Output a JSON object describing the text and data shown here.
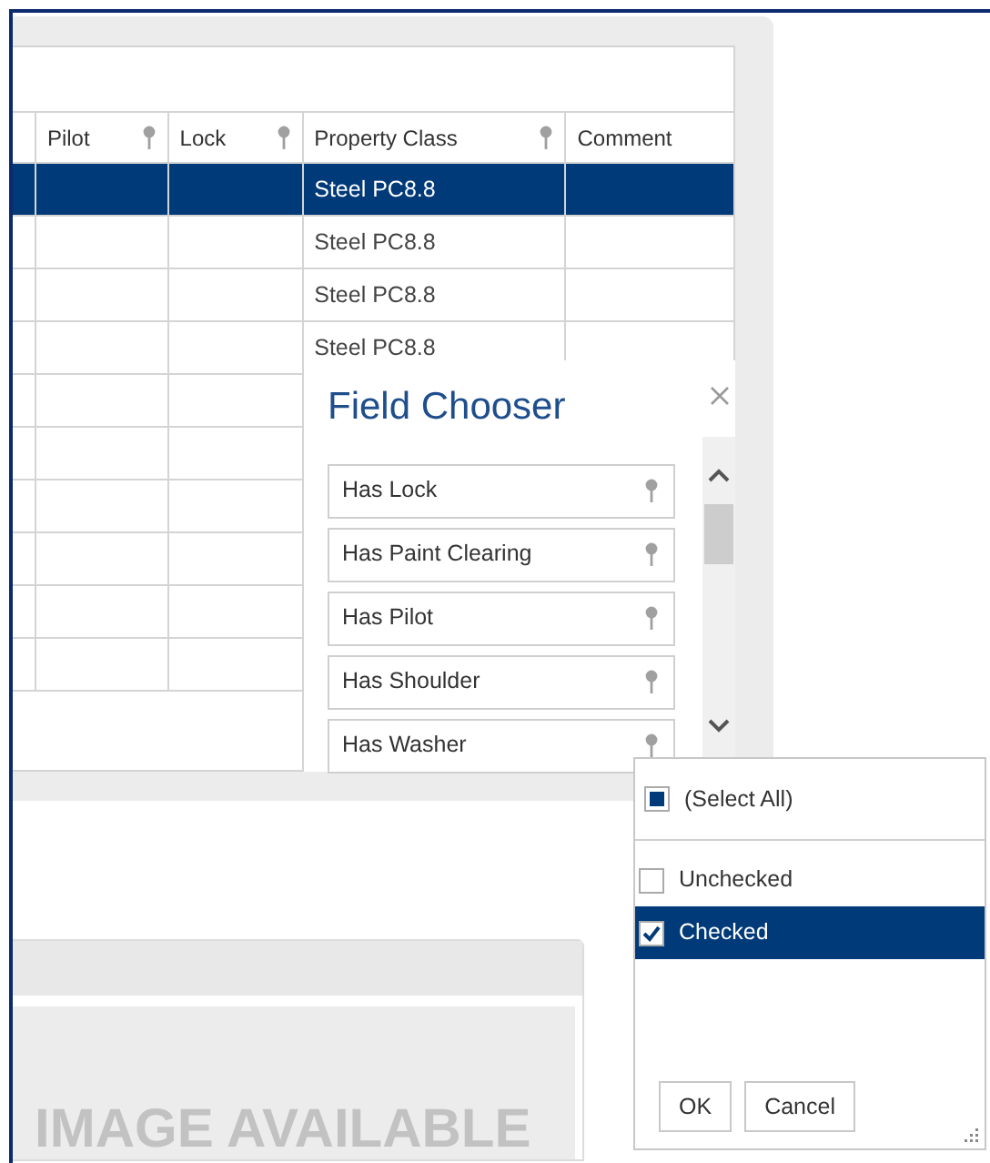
{
  "grid": {
    "columns": [
      {
        "label": "Pilot",
        "pin": true
      },
      {
        "label": "Lock",
        "pin": true
      },
      {
        "label": "Property Class",
        "pin": true
      },
      {
        "label": "Comment",
        "pin": false
      }
    ],
    "rows": [
      {
        "selected": true,
        "property_class": "Steel PC8.8"
      },
      {
        "selected": false,
        "property_class": "Steel PC8.8"
      },
      {
        "selected": false,
        "property_class": "Steel PC8.8"
      },
      {
        "selected": false,
        "property_class": "Steel PC8.8"
      },
      {
        "selected": false
      },
      {
        "selected": false
      },
      {
        "selected": false
      },
      {
        "selected": false
      },
      {
        "selected": false
      },
      {
        "selected": false
      }
    ]
  },
  "field_chooser": {
    "title": "Field Chooser",
    "fields": [
      "Has Lock",
      "Has Paint Clearing",
      "Has Pilot",
      "Has Shoulder",
      "Has Washer"
    ]
  },
  "filter_popup": {
    "items": [
      {
        "kind": "select_all",
        "label": "(Select All)",
        "checked": false,
        "indeterminate": true,
        "selected": false
      },
      {
        "kind": "value",
        "label": "Unchecked",
        "checked": false,
        "indeterminate": false,
        "selected": false
      },
      {
        "kind": "value",
        "label": "Checked",
        "checked": true,
        "indeterminate": false,
        "selected": true
      }
    ],
    "buttons": [
      "OK",
      "Cancel"
    ]
  },
  "card": {
    "image_text": "IMAGE AVAILABLE"
  }
}
